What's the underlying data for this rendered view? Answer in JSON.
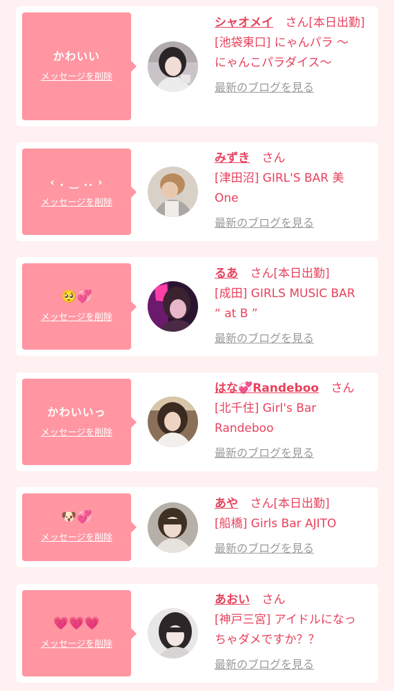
{
  "delete_label": "メッセージを削除",
  "blog_label": "最新のブログを見る",
  "san_label": "さん",
  "cards": [
    {
      "message": "かわいい",
      "name": "シャオメイ",
      "status": "[本日出勤]",
      "shop_line1": "[池袋東口] にゃんパラ 〜",
      "shop_line2": "にゃんこパラダイス〜",
      "avatar_icon": "girl-photo-avatar"
    },
    {
      "message": "‹ . ‿ .. ›",
      "name": "みずき",
      "status": "",
      "shop_line1": "[津田沼] GIRL'S BAR 美",
      "shop_line2": "One",
      "avatar_icon": "girl-photo-avatar"
    },
    {
      "message": "🥺💞",
      "name": "るあ",
      "status": "[本日出勤]",
      "shop_line1": "[成田] GIRLS MUSIC BAR",
      "shop_line2": "“ at B ”",
      "avatar_icon": "girl-photo-avatar"
    },
    {
      "message": "かわいいっ",
      "name": "はな💞Randeboo",
      "status": "",
      "shop_line1": "[北千住] Girl's Bar",
      "shop_line2": "Randeboo",
      "avatar_icon": "girl-photo-avatar"
    },
    {
      "message": "🐶💞",
      "name": "あや",
      "status": "[本日出勤]",
      "shop_line1": "[船橋] Girls Bar AJITO",
      "shop_line2": "",
      "avatar_icon": "girl-photo-avatar"
    },
    {
      "message": "💗💗💗",
      "name": "あおい",
      "status": "",
      "shop_line1": "[神戸三宮] アイドルになっ",
      "shop_line2": "ちゃダメですか？？",
      "avatar_icon": "girl-photo-avatar"
    }
  ],
  "colors": {
    "page_bg": "#fff0f1",
    "bubble": "#ff96a2",
    "accent_text": "#e8415c",
    "blog_link": "#9a9a9a"
  }
}
